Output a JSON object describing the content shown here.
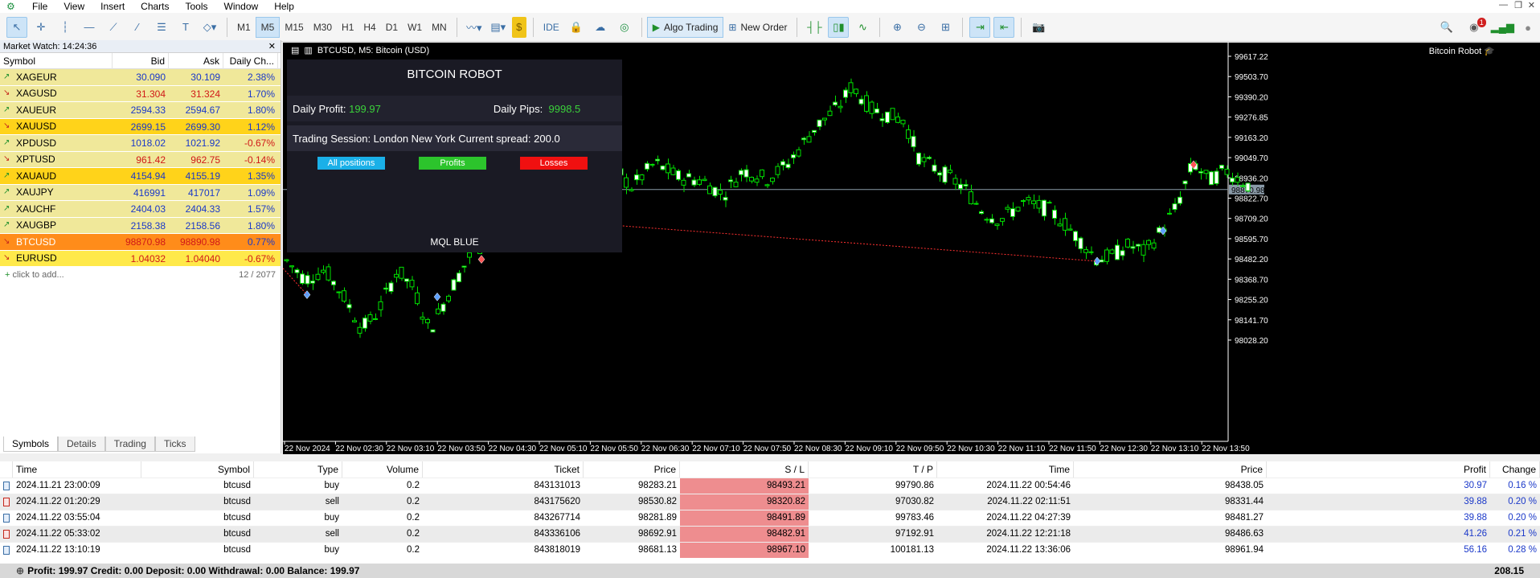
{
  "menu": {
    "items": [
      "File",
      "View",
      "Insert",
      "Charts",
      "Tools",
      "Window",
      "Help"
    ]
  },
  "toolbar": {
    "timeframes": [
      "M1",
      "M5",
      "M15",
      "M30",
      "H1",
      "H4",
      "D1",
      "W1",
      "MN"
    ],
    "active_timeframe": "M5",
    "ide_label": "IDE",
    "algo_trading_label": "Algo Trading",
    "new_order_label": "New Order",
    "notification_count": "1"
  },
  "market_watch": {
    "title": "Market Watch: 14:24:36",
    "columns": [
      "Symbol",
      "Bid",
      "Ask",
      "Daily Ch..."
    ],
    "rows": [
      {
        "symbol": "XAGEUR",
        "bid": "30.090",
        "ask": "30.109",
        "change": "2.38%",
        "dir": "up",
        "bg": "#f0e89a",
        "bidColor": "blue",
        "changeColor": "blue"
      },
      {
        "symbol": "XAGUSD",
        "bid": "31.304",
        "ask": "31.324",
        "change": "1.70%",
        "dir": "down",
        "bg": "#f0e89a",
        "bidColor": "red",
        "changeColor": "blue"
      },
      {
        "symbol": "XAUEUR",
        "bid": "2594.33",
        "ask": "2594.67",
        "change": "1.80%",
        "dir": "up",
        "bg": "#f0e89a",
        "bidColor": "blue",
        "changeColor": "blue"
      },
      {
        "symbol": "XAUUSD",
        "bid": "2699.15",
        "ask": "2699.30",
        "change": "1.12%",
        "dir": "down",
        "bg": "#ffd31a",
        "bidColor": "blue",
        "changeColor": "blue"
      },
      {
        "symbol": "XPDUSD",
        "bid": "1018.02",
        "ask": "1021.92",
        "change": "-0.67%",
        "dir": "up",
        "bg": "#f0e89a",
        "bidColor": "blue",
        "changeColor": "red"
      },
      {
        "symbol": "XPTUSD",
        "bid": "961.42",
        "ask": "962.75",
        "change": "-0.14%",
        "dir": "down",
        "bg": "#f0e89a",
        "bidColor": "red",
        "changeColor": "red"
      },
      {
        "symbol": "XAUAUD",
        "bid": "4154.94",
        "ask": "4155.19",
        "change": "1.35%",
        "dir": "up",
        "bg": "#ffd31a",
        "bidColor": "blue",
        "changeColor": "blue"
      },
      {
        "symbol": "XAUJPY",
        "bid": "416991",
        "ask": "417017",
        "change": "1.09%",
        "dir": "up",
        "bg": "#f0e89a",
        "bidColor": "blue",
        "changeColor": "blue"
      },
      {
        "symbol": "XAUCHF",
        "bid": "2404.03",
        "ask": "2404.33",
        "change": "1.57%",
        "dir": "up",
        "bg": "#f0e89a",
        "bidColor": "blue",
        "changeColor": "blue"
      },
      {
        "symbol": "XAUGBP",
        "bid": "2158.38",
        "ask": "2158.56",
        "change": "1.80%",
        "dir": "up",
        "bg": "#f0e89a",
        "bidColor": "blue",
        "changeColor": "blue"
      },
      {
        "symbol": "BTCUSD",
        "bid": "98870.98",
        "ask": "98890.98",
        "change": "0.77%",
        "dir": "down",
        "bg": "#ff8c1a",
        "bidColor": "red",
        "changeColor": "blue",
        "selected": true
      },
      {
        "symbol": "EURUSD",
        "bid": "1.04032",
        "ask": "1.04040",
        "change": "-0.67%",
        "dir": "down",
        "bg": "#ffe94a",
        "bidColor": "red",
        "changeColor": "red"
      }
    ],
    "add_label": "click to add...",
    "count": "12 / 2077",
    "tabs": [
      "Symbols",
      "Details",
      "Trading",
      "Ticks"
    ]
  },
  "chart": {
    "title": "BTCUSD, M5:  Bitcoin (USD)",
    "robot_label": "Bitcoin Robot",
    "price_labels": [
      "99617.22",
      "99503.70",
      "99390.20",
      "99276.85",
      "99163.20",
      "99049.70",
      "98936.20",
      "98822.70",
      "98709.20",
      "98595.70",
      "98482.20",
      "98368.70",
      "98255.20",
      "98141.70",
      "98028.20"
    ],
    "current_price": "98870.98",
    "time_labels": [
      "22 Nov 2024",
      "22 Nov 02:30",
      "22 Nov 03:10",
      "22 Nov 03:50",
      "22 Nov 04:30",
      "22 Nov 05:10",
      "22 Nov 05:50",
      "22 Nov 06:30",
      "22 Nov 07:10",
      "22 Nov 07:50",
      "22 Nov 08:30",
      "22 Nov 09:10",
      "22 Nov 09:50",
      "22 Nov 10:30",
      "22 Nov 11:10",
      "22 Nov 11:50",
      "22 Nov 12:30",
      "22 Nov 13:10",
      "22 Nov 13:50"
    ]
  },
  "robot_panel": {
    "title": "BITCOIN ROBOT",
    "daily_profit_label": "Daily Profit:",
    "daily_profit_value": "199.97",
    "daily_pips_label": "Daily Pips:",
    "daily_pips_value": "9998.5",
    "session_text": "Trading Session: London New York  Current spread: 200.0",
    "btn_all": "All positions",
    "btn_profits": "Profits",
    "btn_losses": "Losses",
    "footer": "MQL BLUE",
    "colors": {
      "all": "#1ab0e8",
      "profits": "#2cc42c",
      "losses": "#f01010"
    }
  },
  "trades": {
    "columns": [
      "Time",
      "Symbol",
      "Type",
      "Volume",
      "Ticket",
      "Price",
      "S / L",
      "T / P",
      "Time",
      "Price",
      "Profit",
      "Change"
    ],
    "rows": [
      {
        "time": "2024.11.21 23:00:09",
        "symbol": "btcusd",
        "type": "buy",
        "volume": "0.2",
        "ticket": "843131013",
        "price": "98283.21",
        "sl": "98493.21",
        "tp": "99790.86",
        "close_time": "2024.11.22 00:54:46",
        "close_price": "98438.05",
        "profit": "30.97",
        "change": "0.16 %"
      },
      {
        "time": "2024.11.22 01:20:29",
        "symbol": "btcusd",
        "type": "sell",
        "volume": "0.2",
        "ticket": "843175620",
        "price": "98530.82",
        "sl": "98320.82",
        "tp": "97030.82",
        "close_time": "2024.11.22 02:11:51",
        "close_price": "98331.44",
        "profit": "39.88",
        "change": "0.20 %"
      },
      {
        "time": "2024.11.22 03:55:04",
        "symbol": "btcusd",
        "type": "buy",
        "volume": "0.2",
        "ticket": "843267714",
        "price": "98281.89",
        "sl": "98491.89",
        "tp": "99783.46",
        "close_time": "2024.11.22 04:27:39",
        "close_price": "98481.27",
        "profit": "39.88",
        "change": "0.20 %"
      },
      {
        "time": "2024.11.22 05:33:02",
        "symbol": "btcusd",
        "type": "sell",
        "volume": "0.2",
        "ticket": "843336106",
        "price": "98692.91",
        "sl": "98482.91",
        "tp": "97192.91",
        "close_time": "2024.11.22 12:21:18",
        "close_price": "98486.63",
        "profit": "41.26",
        "change": "0.21 %"
      },
      {
        "time": "2024.11.22 13:10:19",
        "symbol": "btcusd",
        "type": "buy",
        "volume": "0.2",
        "ticket": "843818019",
        "price": "98681.13",
        "sl": "98967.10",
        "tp": "100181.13",
        "close_time": "2024.11.22 13:36:06",
        "close_price": "98961.94",
        "profit": "56.16",
        "change": "0.28 %"
      }
    ],
    "summary": "Profit: 199.97  Credit: 0.00  Deposit: 0.00  Withdrawal: 0.00  Balance: 199.97",
    "total": "208.15"
  }
}
